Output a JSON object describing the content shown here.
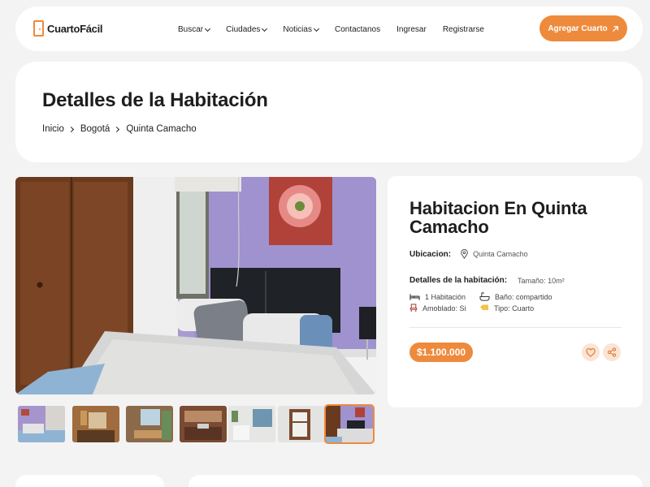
{
  "brand": {
    "logo_text": "CuartoFácil",
    "accent": "#ee8a3c"
  },
  "nav": {
    "items": [
      {
        "label": "Buscar",
        "dropdown": true
      },
      {
        "label": "Ciudades",
        "dropdown": true
      },
      {
        "label": "Noticias",
        "dropdown": true
      },
      {
        "label": "Contactanos",
        "dropdown": false
      },
      {
        "label": "Ingresar",
        "dropdown": false
      },
      {
        "label": "Registrarse",
        "dropdown": false
      }
    ],
    "cta_label": "Agregar Cuarto"
  },
  "header": {
    "title": "Detalles de la Habitación",
    "breadcrumb": [
      "Inicio",
      "Bogotá",
      "Quinta Camacho"
    ]
  },
  "gallery": {
    "thumbnails": [
      {
        "icon": "bedroom-thumb",
        "active": false
      },
      {
        "icon": "living-room-thumb",
        "active": false
      },
      {
        "icon": "dining-room-thumb",
        "active": false
      },
      {
        "icon": "kitchen-thumb",
        "active": false
      },
      {
        "icon": "bathroom-thumb",
        "active": false
      },
      {
        "icon": "closet-thumb",
        "active": false
      },
      {
        "icon": "bedroom-thumb",
        "active": true
      }
    ]
  },
  "room": {
    "title": "Habitacion En Quinta Camacho",
    "location_label": "Ubicacion:",
    "location_value": "Quinta Camacho",
    "details_label": "Detalles de la habitación:",
    "size": "Tamaño: 10m²",
    "features": {
      "rooms": "1 Habitación",
      "bath": "Baño: compartido",
      "furnished": "Amoblado: Si",
      "type": "Tipo: Cuarto"
    },
    "price": "$1.100.000"
  }
}
